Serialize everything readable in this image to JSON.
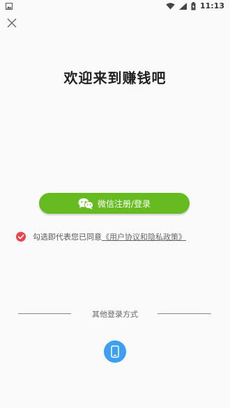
{
  "status_bar": {
    "time": "11:13",
    "icons": [
      "image-icon",
      "wifi-icon",
      "signal-icon",
      "battery-charging-icon"
    ]
  },
  "close_icon": "close-icon",
  "welcome": {
    "title": "欢迎来到赚钱吧"
  },
  "wechat_button": {
    "label": "微信注册/登录",
    "icon": "wechat-icon",
    "color": "#66bb21"
  },
  "agreement": {
    "checked": true,
    "prefix": "勾选即代表您已同意",
    "policy_link": "《用户协议和隐私政策》",
    "check_color": "#e8464c"
  },
  "other_login": {
    "label": "其他登录方式",
    "methods": [
      {
        "icon": "phone-icon",
        "color": "#3d9ef3"
      }
    ]
  }
}
